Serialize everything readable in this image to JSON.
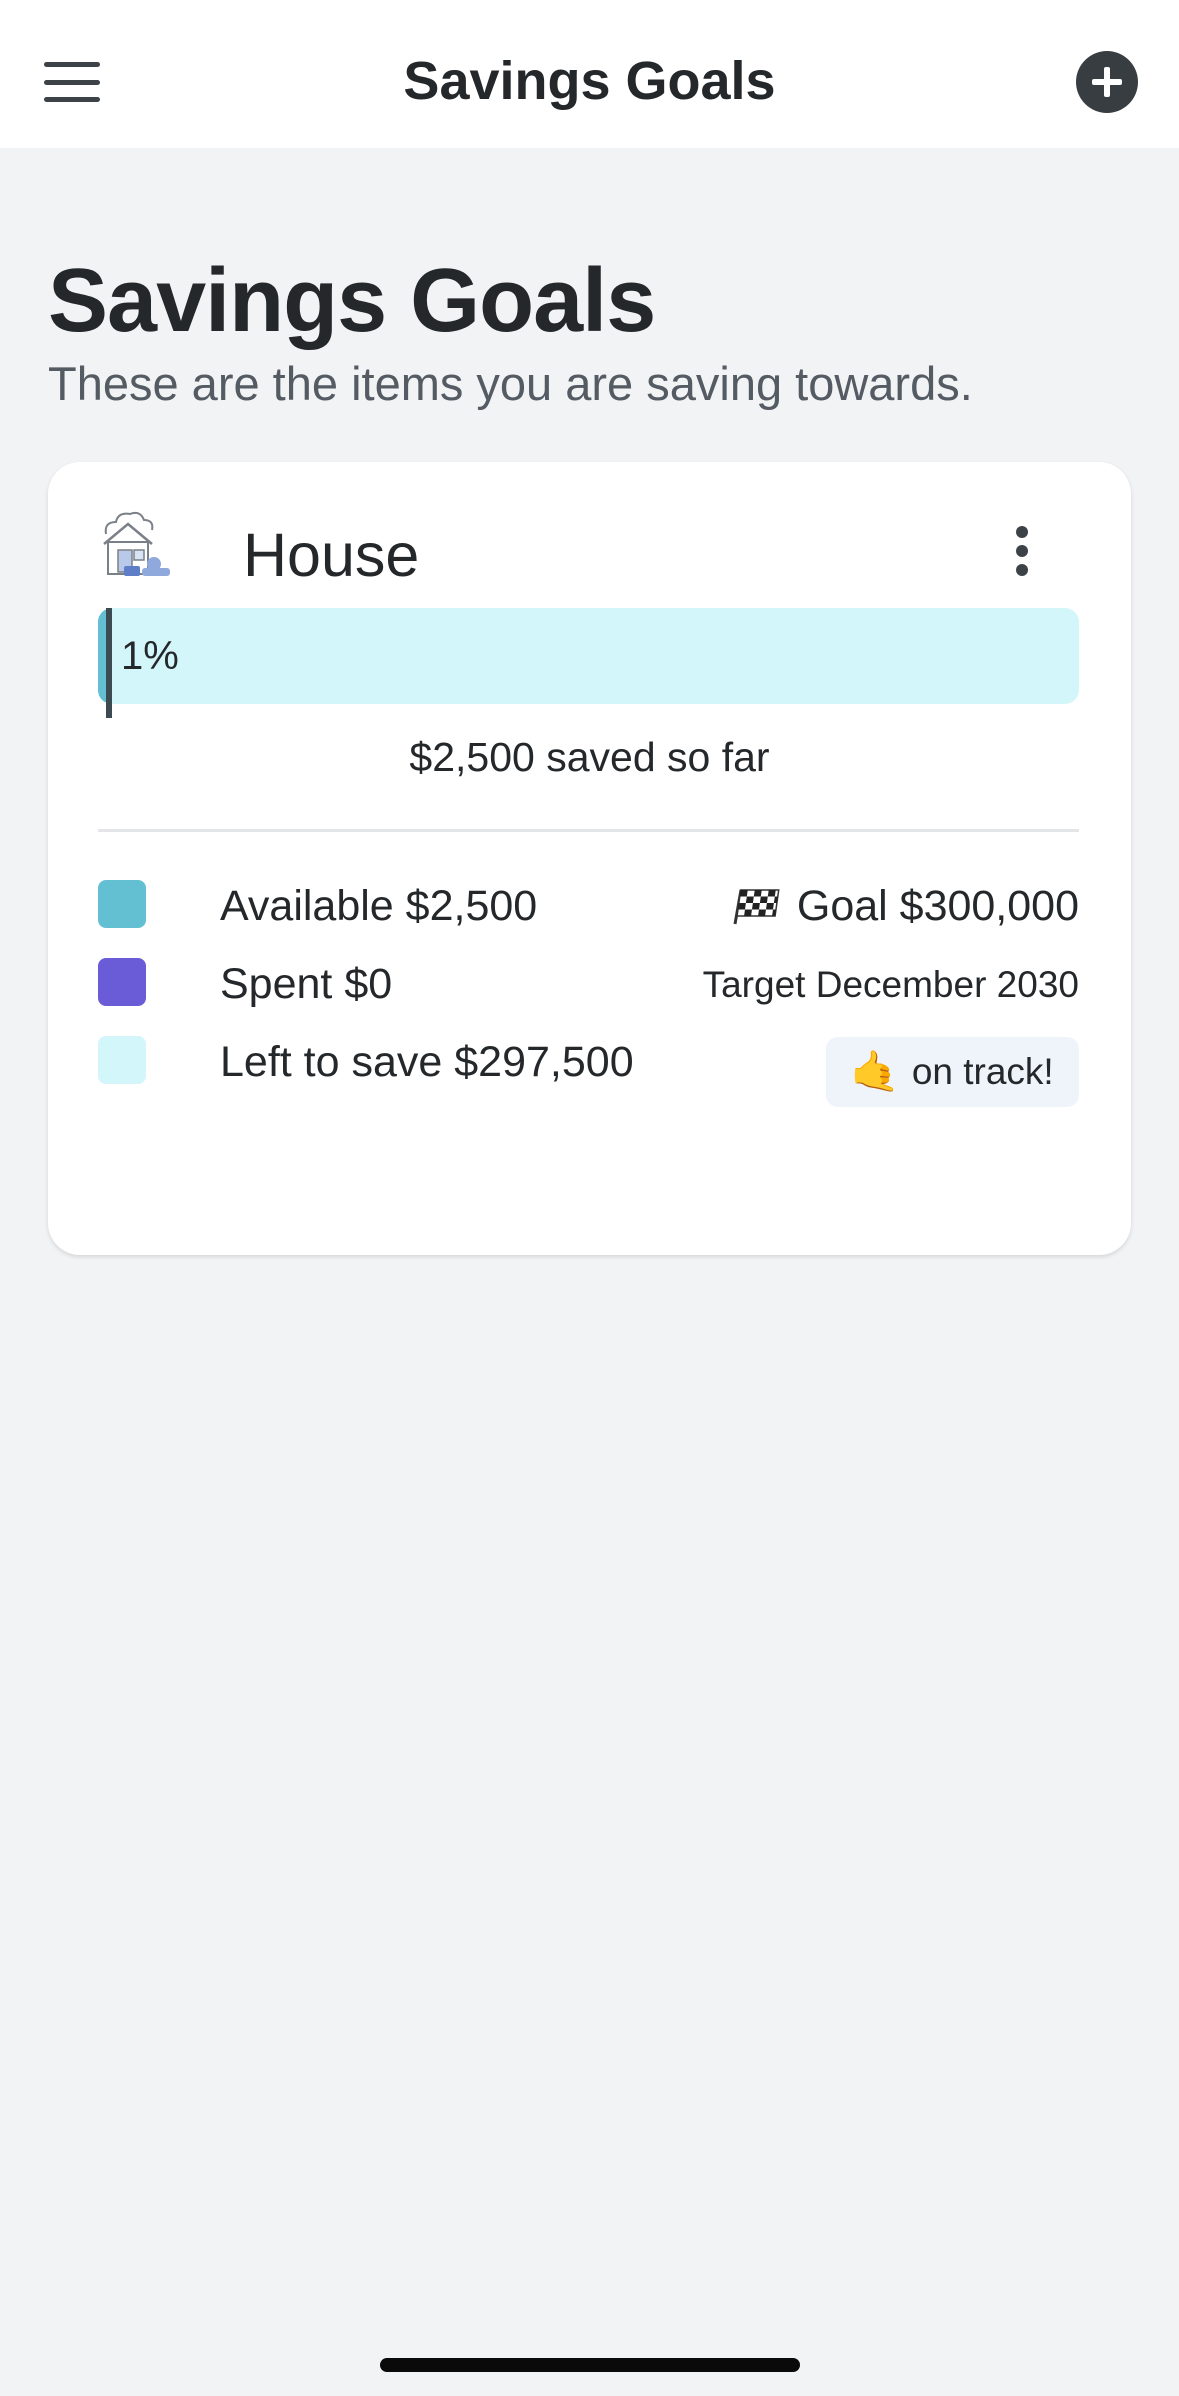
{
  "header": {
    "title": "Savings Goals"
  },
  "page": {
    "title": "Savings Goals",
    "subtitle": "These are the items you are saving towards."
  },
  "goal": {
    "icon": "house-icon",
    "name": "House",
    "progress_percent": 1,
    "progress_label": "1%",
    "saved_text": "$2,500 saved so far",
    "legend": [
      {
        "label": "Available $2,500",
        "color": "#63c0d3"
      },
      {
        "label": "Spent $0",
        "color": "#6a5bd6"
      },
      {
        "label": "Left to save $297,500",
        "color": "#d3f6fb"
      }
    ],
    "goal_text": "Goal $300,000",
    "target_text": "Target December 2030",
    "status_text": "on track!"
  },
  "colors": {
    "accent": "#63c0d3",
    "spent": "#6a5bd6",
    "remaining": "#d3f6fb",
    "background": "#f2f3f5"
  }
}
